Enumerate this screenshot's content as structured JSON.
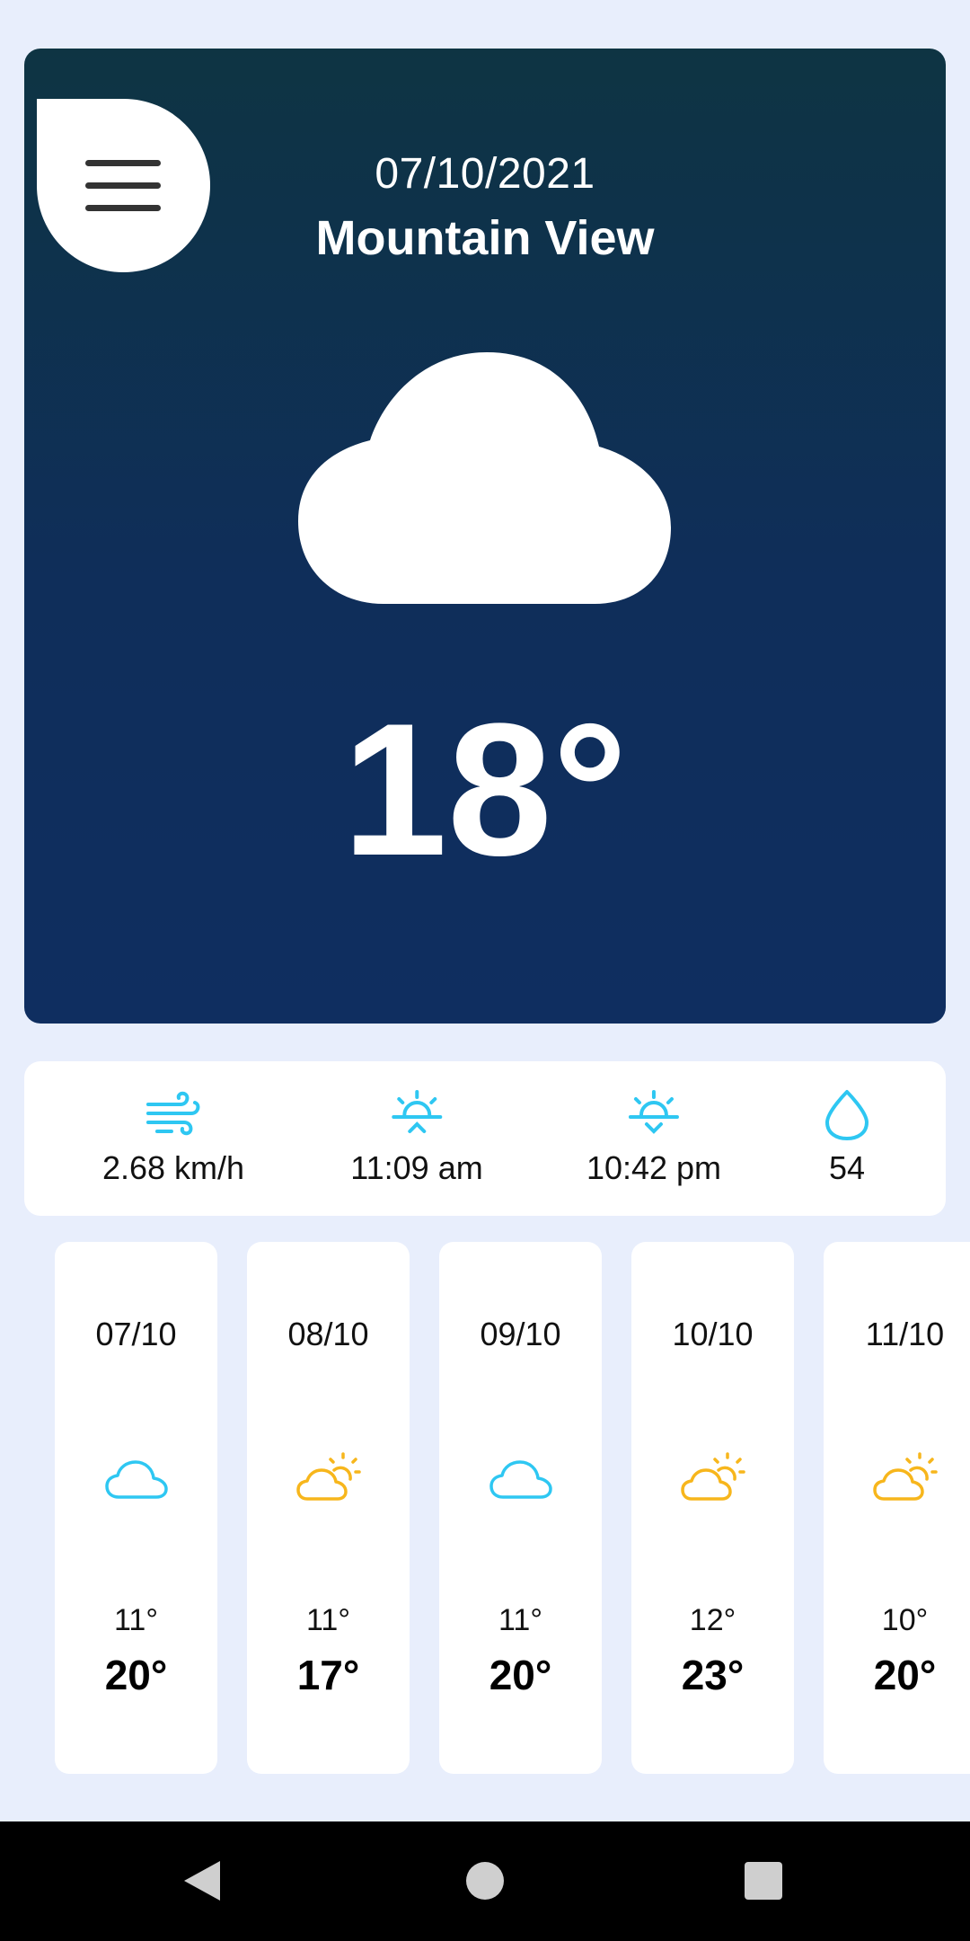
{
  "header": {
    "date": "07/10/2021",
    "city": "Mountain View",
    "condition_icon": "cloud-icon",
    "temperature": "18°"
  },
  "stats": [
    {
      "icon": "wind-icon",
      "value": "2.68 km/h"
    },
    {
      "icon": "sunrise-icon",
      "value": "11:09 am"
    },
    {
      "icon": "sunset-icon",
      "value": "10:42 pm"
    },
    {
      "icon": "humidity-icon",
      "value": "54"
    }
  ],
  "forecast": [
    {
      "date": "07/10",
      "icon": "cloud-icon",
      "low": "11°",
      "high": "20°"
    },
    {
      "date": "08/10",
      "icon": "partly-sunny-icon",
      "low": "11°",
      "high": "17°"
    },
    {
      "date": "09/10",
      "icon": "cloud-icon",
      "low": "11°",
      "high": "20°"
    },
    {
      "date": "10/10",
      "icon": "partly-sunny-icon",
      "low": "12°",
      "high": "23°"
    },
    {
      "date": "11/10",
      "icon": "partly-sunny-icon",
      "low": "10°",
      "high": "20°"
    }
  ],
  "colors": {
    "accent_blue": "#2ec7f2",
    "accent_yellow": "#f7b61c",
    "hero_top": "#0e3443",
    "hero_bottom": "#0f2e60",
    "background": "#e8eefc"
  }
}
